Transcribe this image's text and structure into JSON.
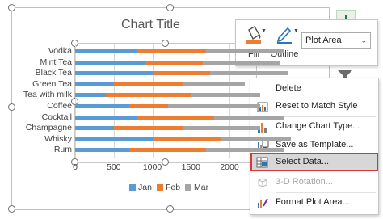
{
  "chart": {
    "title": "Chart Title",
    "x_ticks": [
      "0",
      "500",
      "1000",
      "1500",
      "2000"
    ],
    "legend": [
      {
        "name": "Jan",
        "color": "#5b9bd5"
      },
      {
        "name": "Feb",
        "color": "#ed7d31"
      },
      {
        "name": "Mar",
        "color": "#a5a5a5"
      }
    ]
  },
  "chart_data": {
    "type": "bar",
    "orientation": "horizontal",
    "stacked": true,
    "title": "Chart Title",
    "categories": [
      "Vodka",
      "Mint Tea",
      "Black Tea",
      "Green Tea",
      "Tea with milk",
      "Coffee",
      "Cocktail",
      "Champagne",
      "Whisky",
      "Rum"
    ],
    "series": [
      {
        "name": "Jan",
        "color": "#5b9bd5",
        "values": [
          800,
          900,
          1000,
          500,
          400,
          700,
          800,
          500,
          1000,
          700
        ]
      },
      {
        "name": "Feb",
        "color": "#ed7d31",
        "values": [
          900,
          750,
          750,
          900,
          1100,
          500,
          1000,
          900,
          900,
          1000
        ]
      },
      {
        "name": "Mar",
        "color": "#a5a5a5",
        "values": [
          1000,
          1000,
          1000,
          800,
          900,
          1200,
          900,
          1000,
          900,
          1000
        ]
      }
    ],
    "xlim": [
      0,
      2400
    ],
    "x_ticks": [
      0,
      500,
      1000,
      1500,
      2000
    ],
    "legend_position": "bottom",
    "grid": true
  },
  "toolbar": {
    "fill_label": "Fill",
    "outline_label": "Outline",
    "element_select_value": "Plot Area"
  },
  "context_menu": {
    "items": [
      {
        "label": "Delete",
        "disabled": false
      },
      {
        "label": "Reset to Match Style",
        "disabled": false
      },
      {
        "label": "Change Chart Type...",
        "disabled": false
      },
      {
        "label": "Save as Template...",
        "disabled": false
      },
      {
        "label": "Select Data...",
        "disabled": false
      },
      {
        "label": "3-D Rotation...",
        "disabled": true
      },
      {
        "label": "Format Plot Area...",
        "disabled": false
      }
    ]
  }
}
